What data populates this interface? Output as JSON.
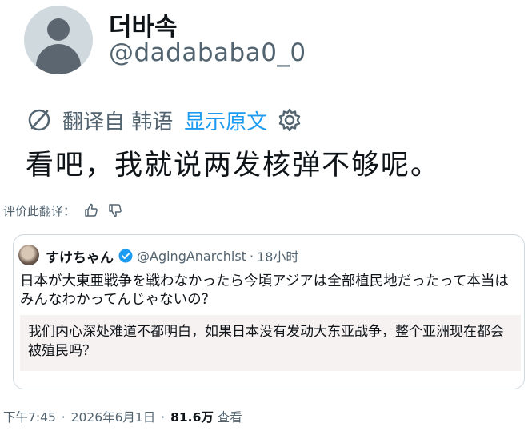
{
  "author": {
    "display_name": "더바속",
    "handle": "@dadababa0_0",
    "avatar": "default-avatar-icon"
  },
  "translation_bar": {
    "icon": "translate-icon",
    "from_label": "翻译自 韩语",
    "show_original_label": "显示原文",
    "settings_icon": "gear-icon"
  },
  "tweet": {
    "text": "看吧，我就说两发核弹不够呢。"
  },
  "rate_translation": {
    "label": "评价此翻译：",
    "thumbs_up_icon": "thumbs-up-icon",
    "thumbs_down_icon": "thumbs-down-icon"
  },
  "quoted_tweet": {
    "display_name": "すけちゃん",
    "verified_icon": "verified-badge-icon",
    "handle": "@AgingAnarchist",
    "separator": "·",
    "time": "18小时",
    "text": "日本が大東亜戦争を戦わなかったら今頃アジアは全部植民地だったって本当はみんなわかってんじゃないの？",
    "translation": "我们内心深处难道不都明白，如果日本没有发动大东亚战争，整个亚洲现在都会被殖民吗？"
  },
  "footer": {
    "time": "下午7:45",
    "separator": "·",
    "date": "2026年6月1日",
    "views_count": "81.6万",
    "views_label": "查看"
  },
  "colors": {
    "link": "#1d9bf0",
    "secondary_text": "#536471",
    "verified": "#1d9bf0",
    "translation_bg": "#f7f2f2"
  }
}
